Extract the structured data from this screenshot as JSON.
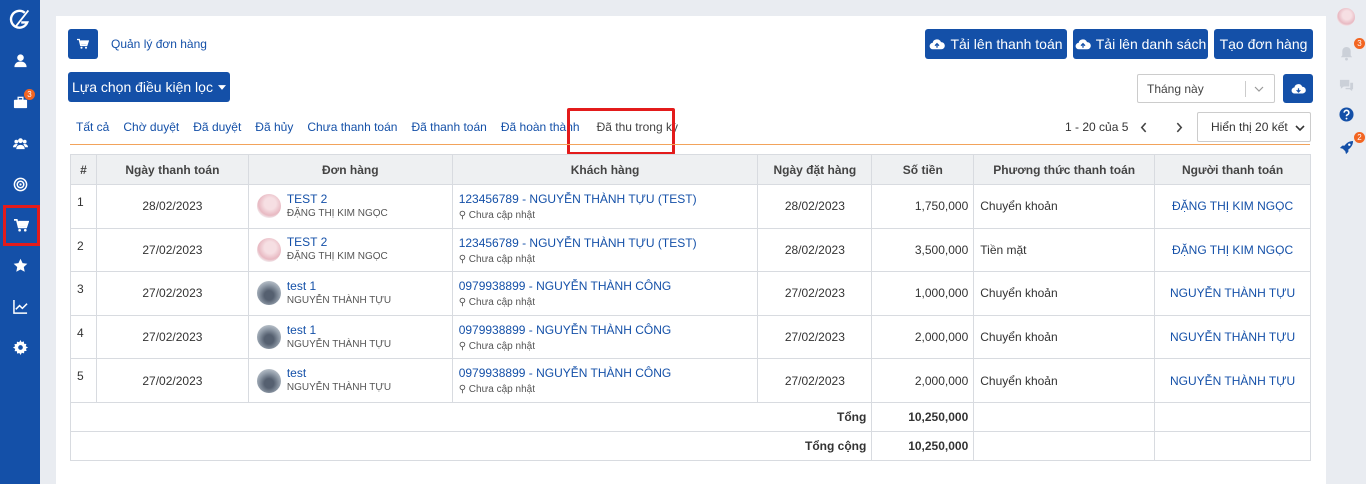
{
  "breadcrumb": "Quản lý đơn hàng",
  "buttons": {
    "upload_payment": "Tải lên thanh toán",
    "upload_list": "Tải lên danh sách",
    "create_order": "Tạo đơn hàng",
    "filter": "Lựa chọn điều kiện lọc"
  },
  "period": {
    "value": "Tháng này"
  },
  "tabs": [
    "Tất cả",
    "Chờ duyệt",
    "Đã duyệt",
    "Đã hủy",
    "Chưa thanh toán",
    "Đã thanh toán",
    "Đã hoàn thành",
    "Đã thu trong kỳ"
  ],
  "pagination": {
    "info": "1 - 20 của 5",
    "per_page": "Hiển thị 20 kết"
  },
  "sidebar_badges": {
    "briefcase": "3"
  },
  "rightbar_badges": {
    "bell": "3",
    "rocket": "2"
  },
  "table": {
    "headers": [
      "#",
      "Ngày thanh toán",
      "Đơn hàng",
      "Khách hàng",
      "Ngày đặt hàng",
      "Số tiền",
      "Phương thức thanh toán",
      "Người thanh toán"
    ],
    "rows": [
      {
        "no": "1",
        "pay_date": "28/02/2023",
        "order": "TEST 2",
        "order_sub": "ĐẶNG THỊ KIM NGỌC",
        "customer": "123456789 - NGUYỄN THÀNH TỰU (TEST)",
        "customer_sub": "Chưa cập nhật",
        "order_date": "28/02/2023",
        "amount": "1,750,000",
        "method": "Chuyển khoản",
        "payer": "ĐẶNG THỊ KIM NGỌC",
        "avatar": "pink"
      },
      {
        "no": "2",
        "pay_date": "27/02/2023",
        "order": "TEST 2",
        "order_sub": "ĐẶNG THỊ KIM NGỌC",
        "customer": "123456789 - NGUYỄN THÀNH TỰU (TEST)",
        "customer_sub": "Chưa cập nhật",
        "order_date": "28/02/2023",
        "amount": "3,500,000",
        "method": "Tiền mặt",
        "payer": "ĐẶNG THỊ KIM NGỌC",
        "avatar": "pink"
      },
      {
        "no": "3",
        "pay_date": "27/02/2023",
        "order": "test 1",
        "order_sub": "NGUYỄN THÀNH TỰU",
        "customer": "0979938899 - NGUYỄN THÀNH CÔNG",
        "customer_sub": "Chưa cập nhật",
        "order_date": "27/02/2023",
        "amount": "1,000,000",
        "method": "Chuyển khoản",
        "payer": "NGUYỄN THÀNH TỰU",
        "avatar": "gray"
      },
      {
        "no": "4",
        "pay_date": "27/02/2023",
        "order": "test 1",
        "order_sub": "NGUYỄN THÀNH TỰU",
        "customer": "0979938899 - NGUYỄN THÀNH CÔNG",
        "customer_sub": "Chưa cập nhật",
        "order_date": "27/02/2023",
        "amount": "2,000,000",
        "method": "Chuyển khoản",
        "payer": "NGUYỄN THÀNH TỰU",
        "avatar": "gray"
      },
      {
        "no": "5",
        "pay_date": "27/02/2023",
        "order": "test",
        "order_sub": "NGUYỄN THÀNH TỰU",
        "customer": "0979938899 - NGUYỄN THÀNH CÔNG",
        "customer_sub": "Chưa cập nhật",
        "order_date": "27/02/2023",
        "amount": "2,000,000",
        "method": "Chuyển khoản",
        "payer": "NGUYỄN THÀNH TỰU",
        "avatar": "gray"
      }
    ],
    "subtotal_label": "Tổng",
    "subtotal": "10,250,000",
    "total_label": "Tổng cộng",
    "total": "10,250,000"
  }
}
